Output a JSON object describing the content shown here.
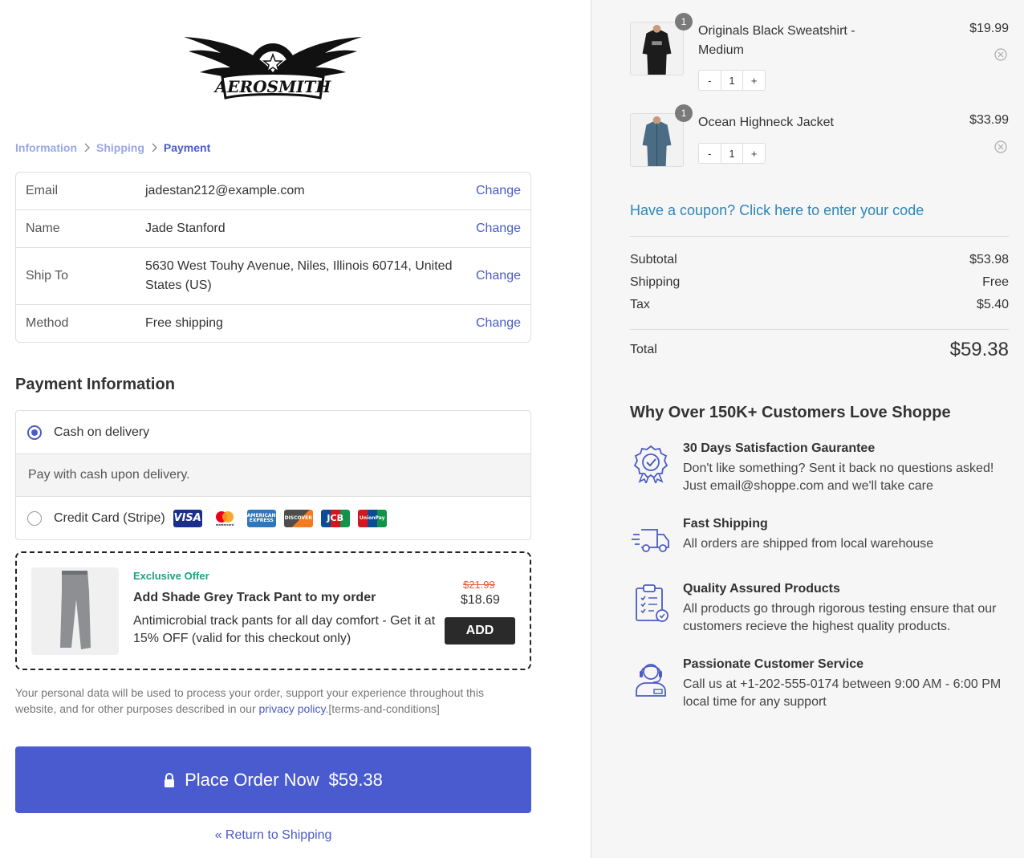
{
  "brand": {
    "logo_name": "Aerosmith"
  },
  "breadcrumb": {
    "step1": "Information",
    "step2": "Shipping",
    "step3": "Payment"
  },
  "summary": {
    "change_label": "Change",
    "rows": [
      {
        "label": "Email",
        "value": "jadestan212@example.com"
      },
      {
        "label": "Name",
        "value": "Jade Stanford"
      },
      {
        "label": "Ship To",
        "value": "5630 West Touhy Avenue, Niles, Illinois 60714, United States (US)"
      },
      {
        "label": "Method",
        "value": "Free shipping"
      }
    ]
  },
  "payment": {
    "title": "Payment Information",
    "cod_label": "Cash on delivery",
    "cod_description": "Pay with cash upon delivery.",
    "card_label": "Credit Card (Stripe)",
    "card_icons": [
      "VISA",
      "mastercard",
      "AMERICAN EXPRESS",
      "DISCOVER",
      "JCB",
      "UnionPay"
    ]
  },
  "offer": {
    "tag": "Exclusive Offer",
    "title": "Add Shade Grey Track Pant to my order",
    "description": "Antimicrobial track pants for all day comfort - Get it at 15% OFF (valid for this checkout only)",
    "old_price": "$21.99",
    "new_price": "$18.69",
    "add_label": "ADD"
  },
  "privacy": {
    "text_before": "Your personal data will be used to process your order, support your experience throughout this website, and for other purposes described in our ",
    "link": "privacy policy",
    "text_after": ".[terms-and-conditions]"
  },
  "place_order": {
    "label": "Place Order Now",
    "amount": "$59.38"
  },
  "return_link": "« Return to Shipping",
  "cart": {
    "items": [
      {
        "qty_badge": "1",
        "name": "Originals Black Sweatshirt - Medium",
        "price": "$19.99",
        "qty": "1"
      },
      {
        "qty_badge": "1",
        "name": "Ocean Highneck Jacket",
        "price": "$33.99",
        "qty": "1"
      }
    ],
    "minus": "-",
    "plus": "+"
  },
  "coupon": "Have a coupon? Click here to enter your code",
  "totals": {
    "subtotal_label": "Subtotal",
    "subtotal": "$53.98",
    "shipping_label": "Shipping",
    "shipping": "Free",
    "tax_label": "Tax",
    "tax": "$5.40",
    "total_label": "Total",
    "total": "$59.38"
  },
  "why": {
    "title": "Why Over 150K+ Customers Love Shoppe",
    "features": [
      {
        "icon": "badge-check-icon",
        "title": "30 Days Satisfaction Gaurantee",
        "desc": "Don't like something? Sent it back no questions asked! Just email@shoppe.com and we'll take care"
      },
      {
        "icon": "truck-icon",
        "title": "Fast Shipping",
        "desc": "All orders are shipped from local warehouse"
      },
      {
        "icon": "clipboard-check-icon",
        "title": "Quality Assured Products",
        "desc": "All products go through rigorous testing ensure that our customers recieve the highest quality products."
      },
      {
        "icon": "support-agent-icon",
        "title": "Passionate Customer Service",
        "desc": "Call us at +1-202-555-0174 between 9:00 AM - 6:00 PM local time for any support"
      }
    ]
  },
  "colors": {
    "accent": "#4a5bd0",
    "link": "#4a5bc6",
    "coupon": "#2e86b8",
    "offer_tag": "#1aa37f",
    "old_price": "#e05a3a"
  }
}
